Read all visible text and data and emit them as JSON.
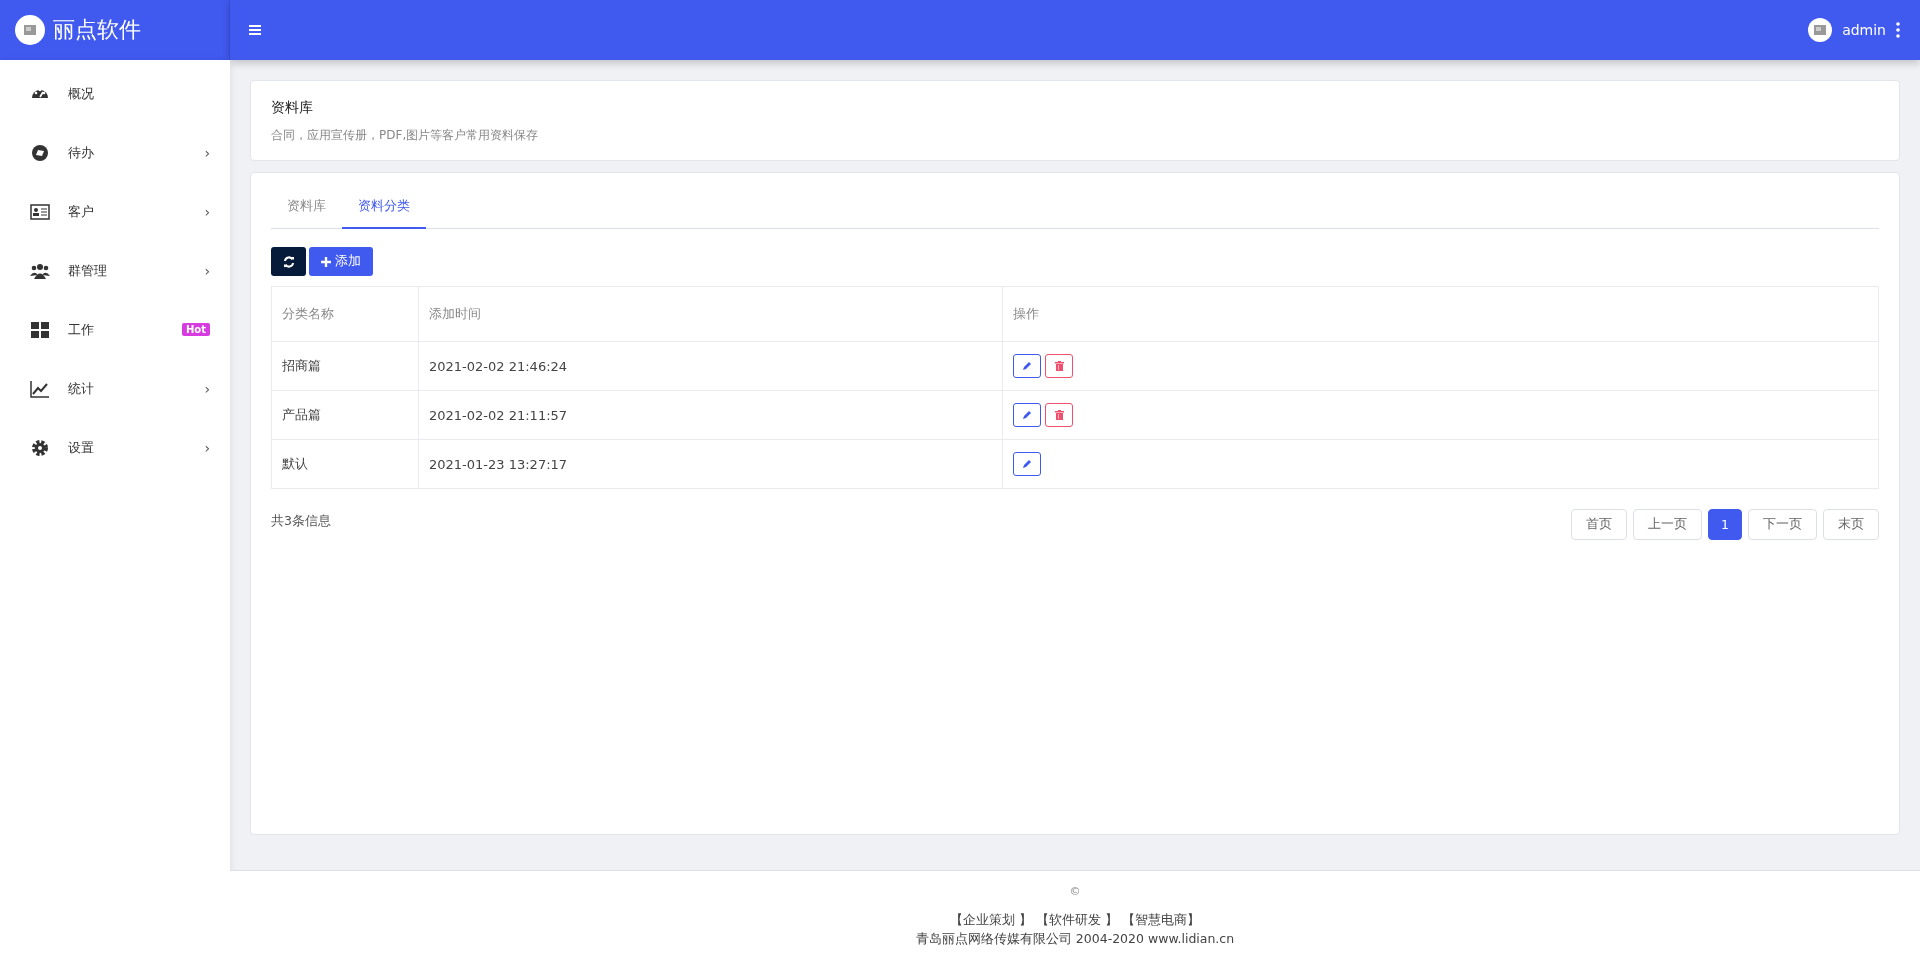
{
  "brand": {
    "name": "丽点软件"
  },
  "header": {
    "user": "admin"
  },
  "sidebar": {
    "items": [
      {
        "label": "概况",
        "kind": "gauge"
      },
      {
        "label": "待办",
        "kind": "disc",
        "chevron": "›"
      },
      {
        "label": "客户",
        "kind": "card",
        "chevron": "›"
      },
      {
        "label": "群管理",
        "kind": "users",
        "chevron": "›"
      },
      {
        "label": "工作",
        "kind": "grid",
        "badge": "Hot"
      },
      {
        "label": "统计",
        "kind": "chart",
        "chevron": "›"
      },
      {
        "label": "设置",
        "kind": "gear",
        "chevron": "›"
      }
    ]
  },
  "page_header": {
    "title": "资料库",
    "subtitle": "合同，应用宣传册，PDF,图片等客户常用资料保存"
  },
  "tabs": [
    {
      "label": "资料库",
      "selected": false
    },
    {
      "label": "资料分类",
      "selected": true
    }
  ],
  "toolbar": {
    "add_button": "添加"
  },
  "table": {
    "columns": [
      "分类名称",
      "添加时间",
      "操作"
    ],
    "rows": [
      {
        "name": "招商篇",
        "time": "2021-02-02 21:46:24",
        "actions": [
          {
            "kind": "edit"
          },
          {
            "kind": "delete"
          }
        ]
      },
      {
        "name": "产品篇",
        "time": "2021-02-02 21:11:57",
        "actions": [
          {
            "kind": "edit"
          },
          {
            "kind": "delete"
          }
        ]
      },
      {
        "name": "默认",
        "time": "2021-01-23 13:27:17",
        "actions": [
          {
            "kind": "edit"
          }
        ]
      }
    ]
  },
  "summary": "共3条信息",
  "pagination": [
    {
      "label": "首页",
      "selected": false
    },
    {
      "label": "上一页",
      "selected": false
    },
    {
      "label": "1",
      "selected": true
    },
    {
      "label": "下一页",
      "selected": false
    },
    {
      "label": "末页",
      "selected": false
    }
  ],
  "footer": {
    "copyright": "©",
    "links": [
      "【企业策划 】",
      "【软件研发 】",
      "【智慧电商】"
    ],
    "company": "青岛丽点网络传媒有限公司 2004-2020 www.lidian.cn"
  }
}
